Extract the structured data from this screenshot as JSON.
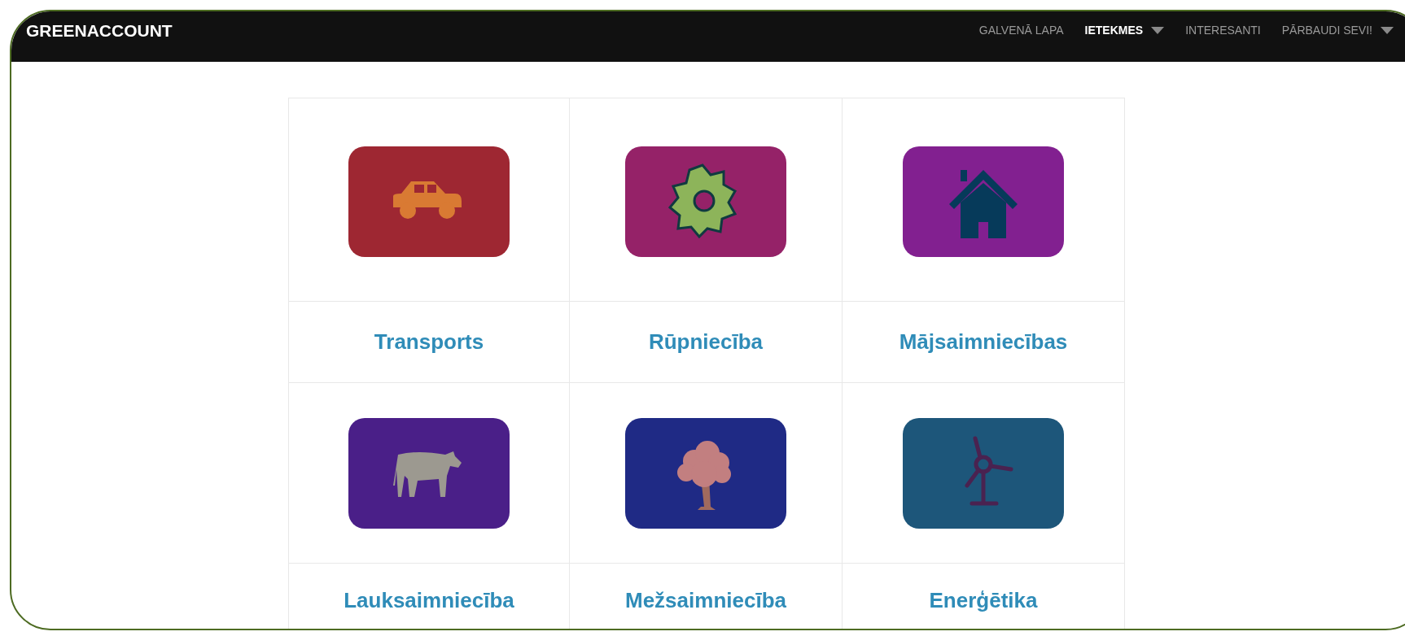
{
  "brand": "GREENACCOUNT",
  "nav": [
    {
      "label": "GALVENĀ LAPA",
      "selected": false,
      "dropdown": false
    },
    {
      "label": "IETEKMES",
      "selected": true,
      "dropdown": true
    },
    {
      "label": "INTERESANTI",
      "selected": false,
      "dropdown": false
    },
    {
      "label": "PĀRBAUDI SEVI!",
      "selected": false,
      "dropdown": true
    }
  ],
  "categories": [
    {
      "label": "Transports",
      "kind": "car",
      "color": "#9e2732"
    },
    {
      "label": "Rūpniecība",
      "kind": "gear",
      "color": "#952268"
    },
    {
      "label": "Mājsaimniecības",
      "kind": "house",
      "color": "#822090"
    },
    {
      "label": "Lauksaimniecība",
      "kind": "cow",
      "color": "#4a1f88"
    },
    {
      "label": "Mežsaimniecība",
      "kind": "tree",
      "color": "#1f2a85"
    },
    {
      "label": "Enerģētika",
      "kind": "turbine",
      "color": "#1d567a"
    }
  ]
}
